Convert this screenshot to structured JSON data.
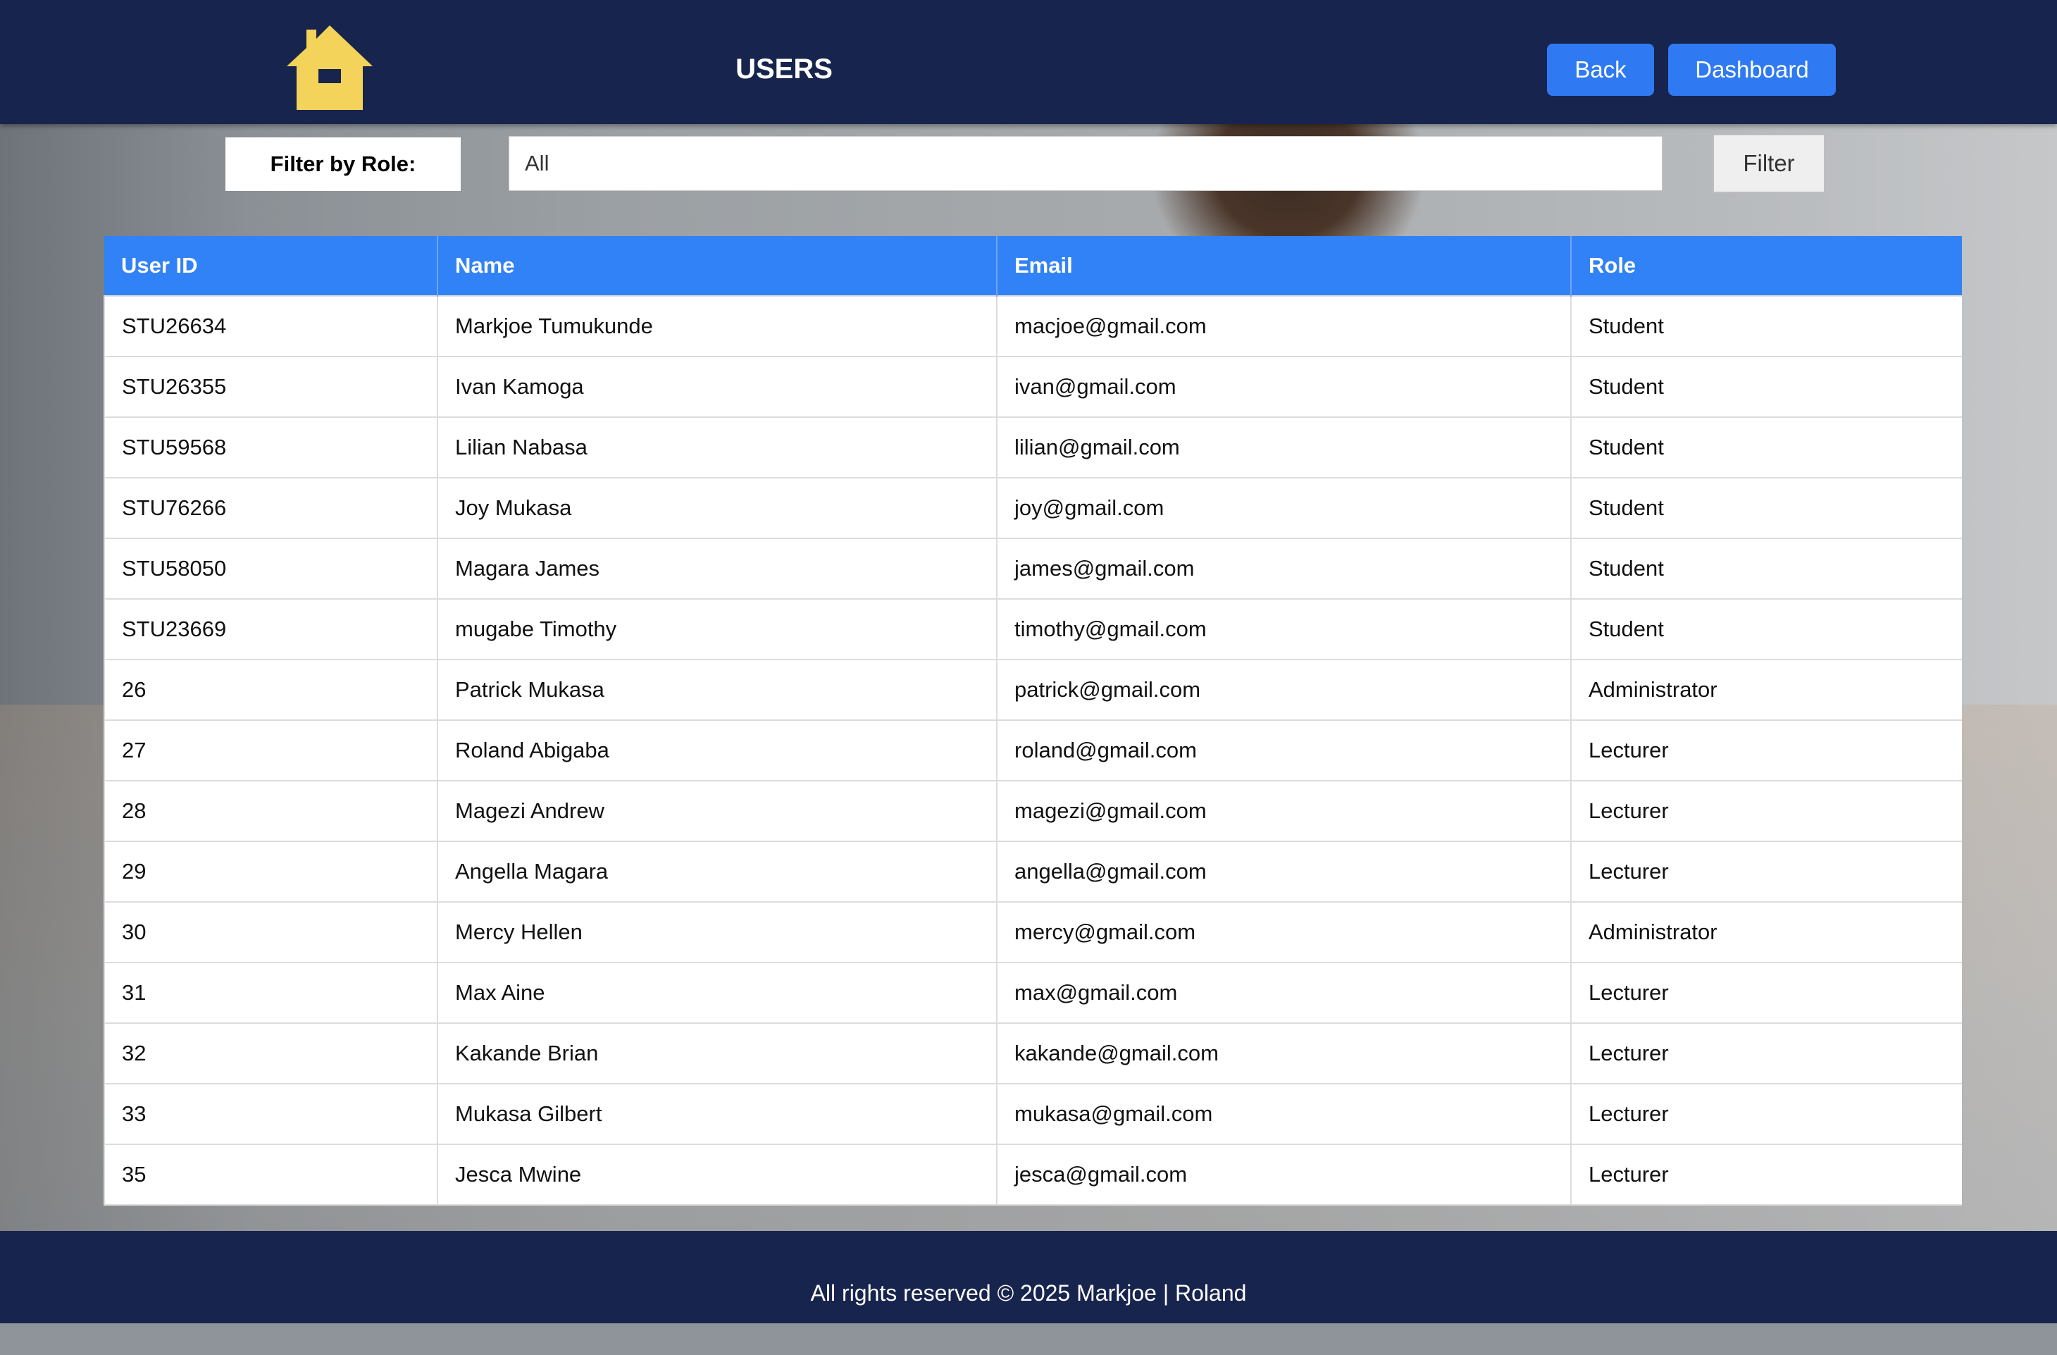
{
  "header": {
    "title": "USERS",
    "back_label": "Back",
    "dashboard_label": "Dashboard",
    "home_icon": "home-icon",
    "home_icon_color": "#f3d35a",
    "bar_color": "#17244d"
  },
  "filter": {
    "label": "Filter by Role:",
    "selected": "All",
    "button_label": "Filter"
  },
  "table": {
    "headers": [
      "User ID",
      "Name",
      "Email",
      "Role"
    ],
    "header_color": "#3282f7",
    "rows": [
      [
        "STU26634",
        "Markjoe Tumukunde",
        "macjoe@gmail.com",
        "Student"
      ],
      [
        "STU26355",
        "Ivan Kamoga",
        "ivan@gmail.com",
        "Student"
      ],
      [
        "STU59568",
        "Lilian Nabasa",
        "lilian@gmail.com",
        "Student"
      ],
      [
        "STU76266",
        "Joy Mukasa",
        "joy@gmail.com",
        "Student"
      ],
      [
        "STU58050",
        "Magara James",
        "james@gmail.com",
        "Student"
      ],
      [
        "STU23669",
        "mugabe Timothy",
        "timothy@gmail.com",
        "Student"
      ],
      [
        "26",
        "Patrick Mukasa",
        "patrick@gmail.com",
        "Administrator"
      ],
      [
        "27",
        "Roland Abigaba",
        "roland@gmail.com",
        "Lecturer"
      ],
      [
        "28",
        "Magezi Andrew",
        "magezi@gmail.com",
        "Lecturer"
      ],
      [
        "29",
        "Angella Magara",
        "angella@gmail.com",
        "Lecturer"
      ],
      [
        "30",
        "Mercy Hellen",
        "mercy@gmail.com",
        "Administrator"
      ],
      [
        "31",
        "Max Aine",
        "max@gmail.com",
        "Lecturer"
      ],
      [
        "32",
        "Kakande Brian",
        "kakande@gmail.com",
        "Lecturer"
      ],
      [
        "33",
        "Mukasa Gilbert",
        "mukasa@gmail.com",
        "Lecturer"
      ],
      [
        "35",
        "Jesca Mwine",
        "jesca@gmail.com",
        "Lecturer"
      ]
    ]
  },
  "footer": {
    "text": "All rights reserved © 2025 Markjoe | Roland"
  }
}
